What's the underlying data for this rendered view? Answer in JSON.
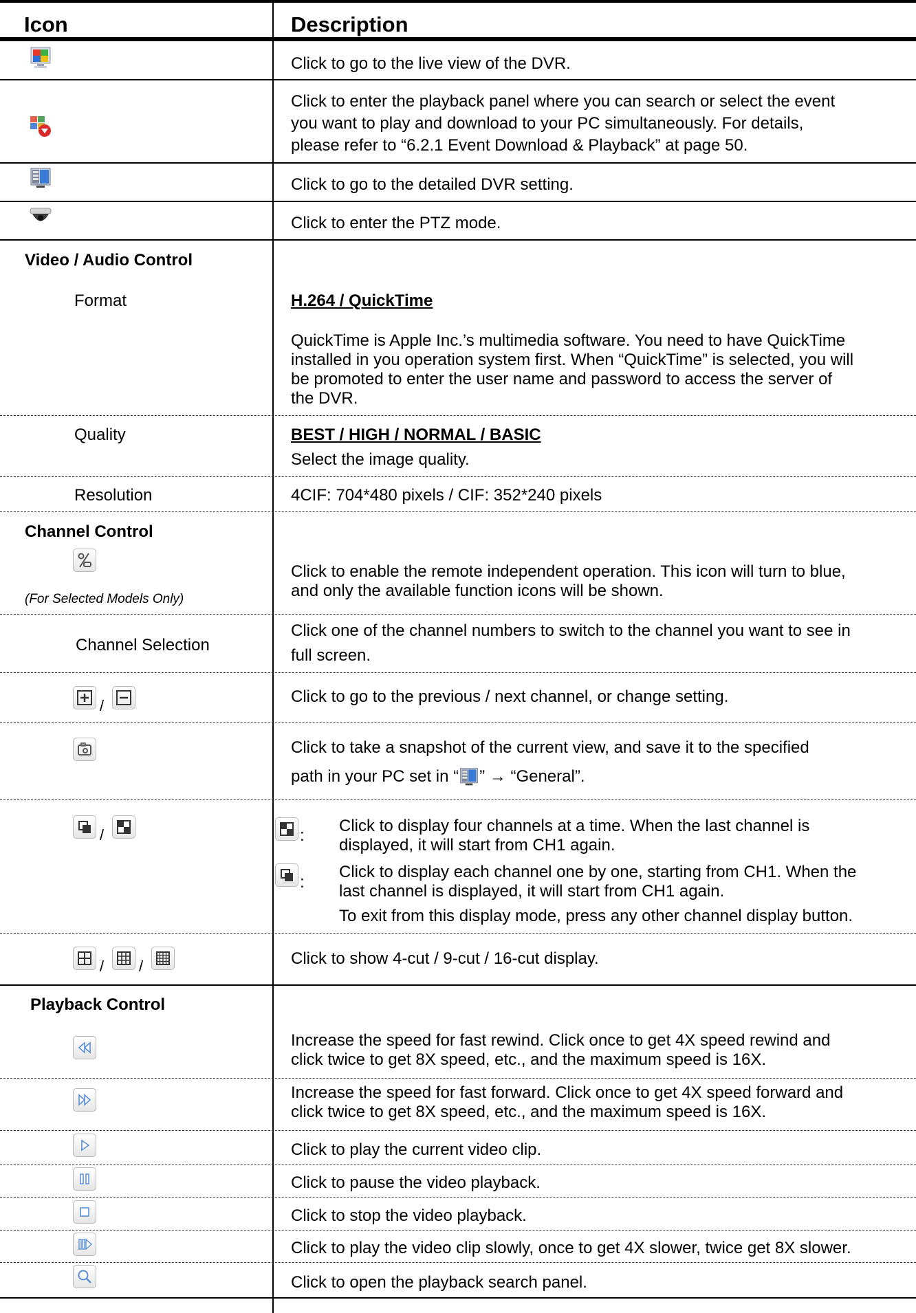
{
  "header": {
    "icon": "Icon",
    "description": "Description"
  },
  "rows": {
    "live": "Click to go to the live view of the DVR.",
    "playback": [
      "Click to enter the playback panel where you can search or select the event",
      "you want to play and download to your PC simultaneously. For details,",
      "please refer to “6.2.1 Event Download & Playback” at page 50."
    ],
    "setting": "Click to go to the detailed DVR setting.",
    "ptz": "Click to enter the PTZ mode."
  },
  "video_audio": {
    "section": "Video / Audio Control",
    "format_label": "Format",
    "format_value": "H.264 / QuickTime",
    "format_desc": [
      "QuickTime is Apple Inc.’s multimedia software. You need to have QuickTime",
      "installed in you operation system first. When “QuickTime” is selected, you will",
      "be promoted to enter the user name and password to access the server of",
      "the DVR."
    ],
    "quality_label": "Quality",
    "quality_value": "BEST / HIGH / NORMAL / BASIC",
    "quality_desc": "Select the image quality.",
    "resolution_label": "Resolution",
    "resolution_desc": "4CIF: 704*480 pixels / CIF: 352*240 pixels"
  },
  "channel": {
    "section": "Channel Control",
    "remote_note": "(For Selected Models Only)",
    "remote_desc": [
      "Click to enable the remote independent operation. This icon will turn to blue,",
      "and only the available function icons will be shown."
    ],
    "selection_label": "Channel Selection",
    "selection_desc": [
      "Click one of the channel numbers to switch to the channel you want to see in",
      "full screen."
    ],
    "prevnext_sep": "/",
    "prevnext_desc": "Click to go to the previous / next channel, or change setting.",
    "snapshot_desc_1": "Click to take a snapshot of the current view, and save it to the specified",
    "snapshot_desc_2a": "path in your PC set in “",
    "snapshot_desc_2b": "” → “General”.",
    "display_sep": "/",
    "quad_colon": ":",
    "quad_desc": [
      "Click to display four channels at a time. When the last channel is",
      "displayed, it will start from CH1 again."
    ],
    "seq_colon": ":",
    "seq_desc": [
      "Click to display each channel one by one, starting from CH1. When the",
      "last channel is displayed, it will start from CH1 again."
    ],
    "exit_desc": "To exit from this display mode, press any other channel display button.",
    "cut_sep_1": "/",
    "cut_sep_2": "/",
    "cut_desc": "Click to show 4-cut / 9-cut / 16-cut display."
  },
  "playback": {
    "section": "Playback Control",
    "rewind_desc": [
      "Increase the speed for fast rewind. Click once to get 4X speed rewind and",
      "click twice to get 8X speed, etc., and the maximum speed is 16X."
    ],
    "forward_desc": [
      "Increase the speed for fast forward. Click once to get 4X speed forward and",
      "click twice to get 8X speed, etc., and the maximum speed is 16X."
    ],
    "play_desc": "Click to play the current video clip.",
    "pause_desc": "Click to pause the video playback.",
    "stop_desc": "Click to stop the video playback.",
    "slow_desc": "Click to play the video clip slowly, once to get 4X slower, twice get 8X slower.",
    "search_desc": "Click to open the playback search panel."
  },
  "colors": {
    "rule": "#000000",
    "button_border": "#b8b8b8",
    "play_blue": "#5b8fd6"
  }
}
